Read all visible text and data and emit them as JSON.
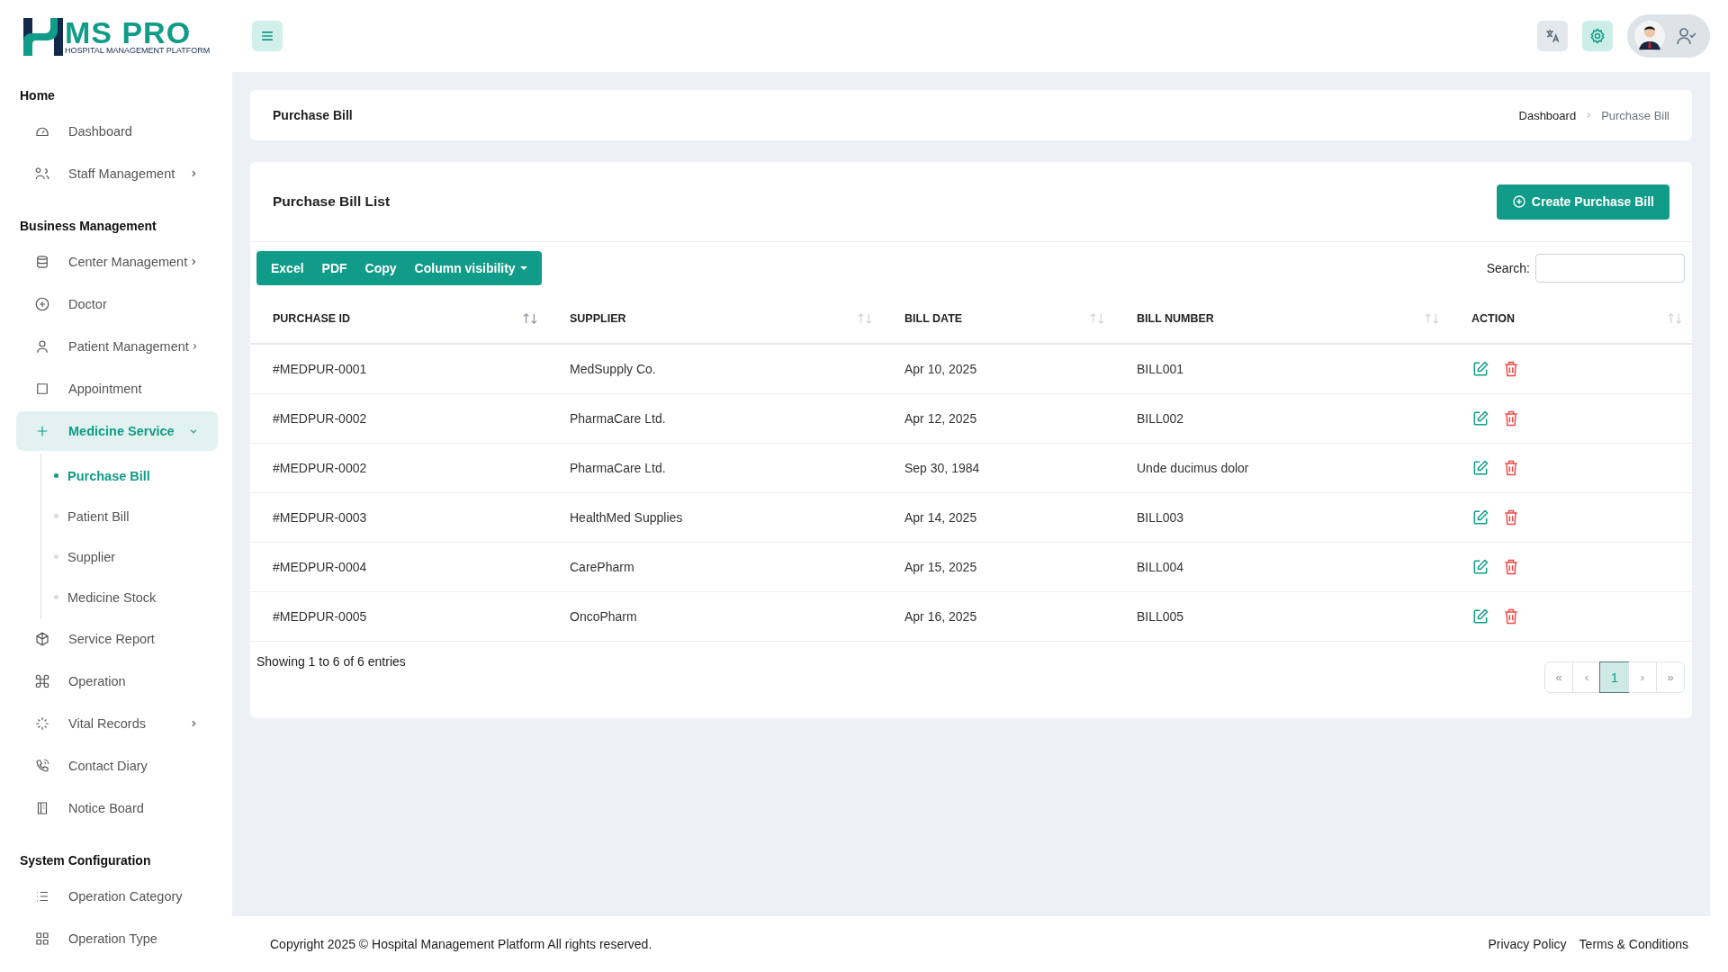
{
  "logo": {
    "title": "MS PRO",
    "subtitle": "HOSPITAL MANAGEMENT PLATFORM"
  },
  "sidebar": {
    "sections": [
      {
        "heading": "Home",
        "items": [
          {
            "label": "Dashboard",
            "expandable": false,
            "selected": false
          },
          {
            "label": "Staff Management",
            "expandable": true,
            "expanded": false,
            "selected": false
          }
        ]
      },
      {
        "heading": "Business Management",
        "items": [
          {
            "label": "Center Management",
            "expandable": true,
            "expanded": false,
            "selected": false
          },
          {
            "label": "Doctor",
            "expandable": false,
            "selected": false
          },
          {
            "label": "Patient Management",
            "expandable": true,
            "expanded": false,
            "selected": false
          },
          {
            "label": "Appointment",
            "expandable": false,
            "selected": false
          },
          {
            "label": "Medicine Service",
            "expandable": true,
            "expanded": true,
            "selected": true,
            "children": [
              {
                "label": "Purchase Bill",
                "selected": true
              },
              {
                "label": "Patient Bill",
                "selected": false
              },
              {
                "label": "Supplier",
                "selected": false
              },
              {
                "label": "Medicine Stock",
                "selected": false
              }
            ]
          },
          {
            "label": "Service Report",
            "expandable": false,
            "selected": false
          },
          {
            "label": "Operation",
            "expandable": false,
            "selected": false
          },
          {
            "label": "Vital Records",
            "expandable": true,
            "expanded": false,
            "selected": false
          },
          {
            "label": "Contact Diary",
            "expandable": false,
            "selected": false
          },
          {
            "label": "Notice Board",
            "expandable": false,
            "selected": false
          }
        ]
      },
      {
        "heading": "System Configuration",
        "items": [
          {
            "label": "Operation Category",
            "expandable": false,
            "selected": false
          },
          {
            "label": "Operation Type",
            "expandable": false,
            "selected": false
          }
        ]
      }
    ]
  },
  "page_header": {
    "title": "Purchase Bill",
    "breadcrumb": [
      {
        "label": "Dashboard",
        "selected": false
      },
      {
        "label": "Purchase Bill",
        "selected": true
      }
    ]
  },
  "card": {
    "title": "Purchase Bill List",
    "create_button": "Create Purchase Bill",
    "export_buttons": [
      {
        "label": "Excel",
        "kind": "button"
      },
      {
        "label": "PDF",
        "kind": "button"
      },
      {
        "label": "Copy",
        "kind": "button"
      },
      {
        "label": "Column visibility",
        "kind": "dropdown"
      }
    ],
    "search_label": "Search:",
    "table": {
      "columns": [
        {
          "label": "PURCHASE ID",
          "sorted": true
        },
        {
          "label": "SUPPLIER",
          "sorted": false
        },
        {
          "label": "BILL DATE",
          "sorted": false
        },
        {
          "label": "BILL NUMBER",
          "sorted": false
        },
        {
          "label": "ACTION",
          "sorted": false
        }
      ],
      "rows": [
        {
          "purchase_id": "#MEDPUR-0001",
          "supplier": "MedSupply Co.",
          "bill_date": "Apr 10, 2025",
          "bill_number": "BILL001"
        },
        {
          "purchase_id": "#MEDPUR-0002",
          "supplier": "PharmaCare Ltd.",
          "bill_date": "Apr 12, 2025",
          "bill_number": "BILL002"
        },
        {
          "purchase_id": "#MEDPUR-0002",
          "supplier": "PharmaCare Ltd.",
          "bill_date": "Sep 30, 1984",
          "bill_number": "Unde ducimus dolor"
        },
        {
          "purchase_id": "#MEDPUR-0003",
          "supplier": "HealthMed Supplies",
          "bill_date": "Apr 14, 2025",
          "bill_number": "BILL003"
        },
        {
          "purchase_id": "#MEDPUR-0004",
          "supplier": "CarePharm",
          "bill_date": "Apr 15, 2025",
          "bill_number": "BILL004"
        },
        {
          "purchase_id": "#MEDPUR-0005",
          "supplier": "OncoPharm",
          "bill_date": "Apr 16, 2025",
          "bill_number": "BILL005"
        }
      ]
    },
    "info": "Showing 1 to 6 of 6 entries",
    "pagination": [
      {
        "label": "«",
        "selected": false
      },
      {
        "label": "‹",
        "selected": false
      },
      {
        "label": "1",
        "selected": true
      },
      {
        "label": "›",
        "selected": false
      },
      {
        "label": "»",
        "selected": false
      }
    ]
  },
  "footer": {
    "copyright": "Copyright 2025 © Hospital Management Platform All rights reserved.",
    "links": [
      "Privacy Policy",
      "Terms & Conditions"
    ]
  }
}
